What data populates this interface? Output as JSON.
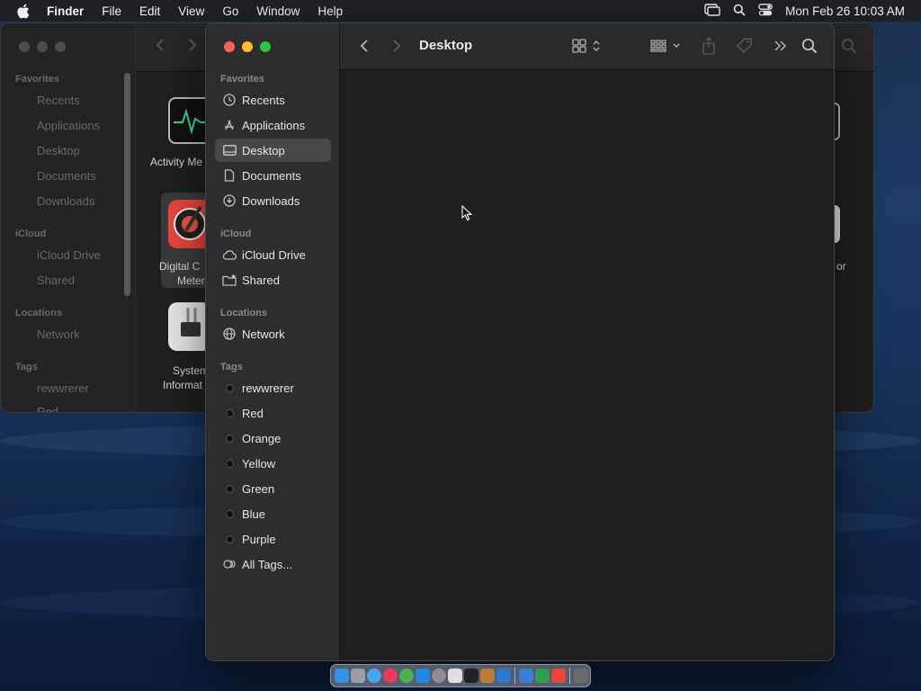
{
  "menubar": {
    "app": "Finder",
    "items": [
      "File",
      "Edit",
      "View",
      "Go",
      "Window",
      "Help"
    ],
    "clock": "Mon Feb 26  10:03 AM"
  },
  "back_window": {
    "sidebar": {
      "favorites_title": "Favorites",
      "favorites": [
        "Recents",
        "Applications",
        "Desktop",
        "Documents",
        "Downloads"
      ],
      "icloud_title": "iCloud",
      "icloud": [
        "iCloud Drive",
        "Shared"
      ],
      "locations_title": "Locations",
      "locations": [
        "Network"
      ],
      "tags_title": "Tags",
      "tags": [
        "rewwrerer",
        "Red"
      ]
    },
    "content": {
      "item1": "Activity Me",
      "item2_line1": "Digital C",
      "item2_line2": "Meter",
      "item3_line1": "System",
      "item3_line2": "Informat",
      "right_label": "or"
    }
  },
  "window": {
    "title": "Desktop",
    "sidebar": {
      "favorites_title": "Favorites",
      "favorites": [
        "Recents",
        "Applications",
        "Desktop",
        "Documents",
        "Downloads"
      ],
      "icloud_title": "iCloud",
      "icloud": [
        "iCloud Drive",
        "Shared"
      ],
      "locations_title": "Locations",
      "locations": [
        "Network"
      ],
      "tags_title": "Tags",
      "tags": [
        "rewwrerer",
        "Red",
        "Orange",
        "Yellow",
        "Green",
        "Blue",
        "Purple",
        "All Tags..."
      ]
    }
  },
  "colors": {
    "traffic_red": "#fe5f57",
    "traffic_yellow": "#febc2e",
    "traffic_green": "#28c840",
    "selected_row": "#474747"
  }
}
